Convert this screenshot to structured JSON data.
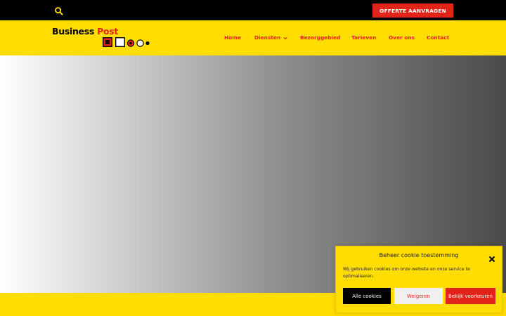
{
  "topbar": {
    "search_icon": "search-icon",
    "quote_button_label": "OFFERTE AANVRAGEN"
  },
  "header": {
    "logo": {
      "word1": "Business",
      "word2": "Post"
    },
    "nav": [
      {
        "label": "Home"
      },
      {
        "label": "Diensten",
        "has_dropdown": true
      },
      {
        "label": "Bezorggebied"
      },
      {
        "label": "Tarieven"
      },
      {
        "label": "Over ons"
      },
      {
        "label": "Contact"
      }
    ]
  },
  "cookie_banner": {
    "title": "Beheer cookie toestemming",
    "text": "Wij gebruiken cookies om onze website en onze service te optimaliseren.",
    "accept_label": "Alle cookies",
    "deny_label": "Weigeren",
    "preferences_label": "Bekijk voorkeuren"
  },
  "colors": {
    "brand_yellow": "#ffdd00",
    "brand_red": "#e2231a",
    "topbar_black": "#000000"
  }
}
